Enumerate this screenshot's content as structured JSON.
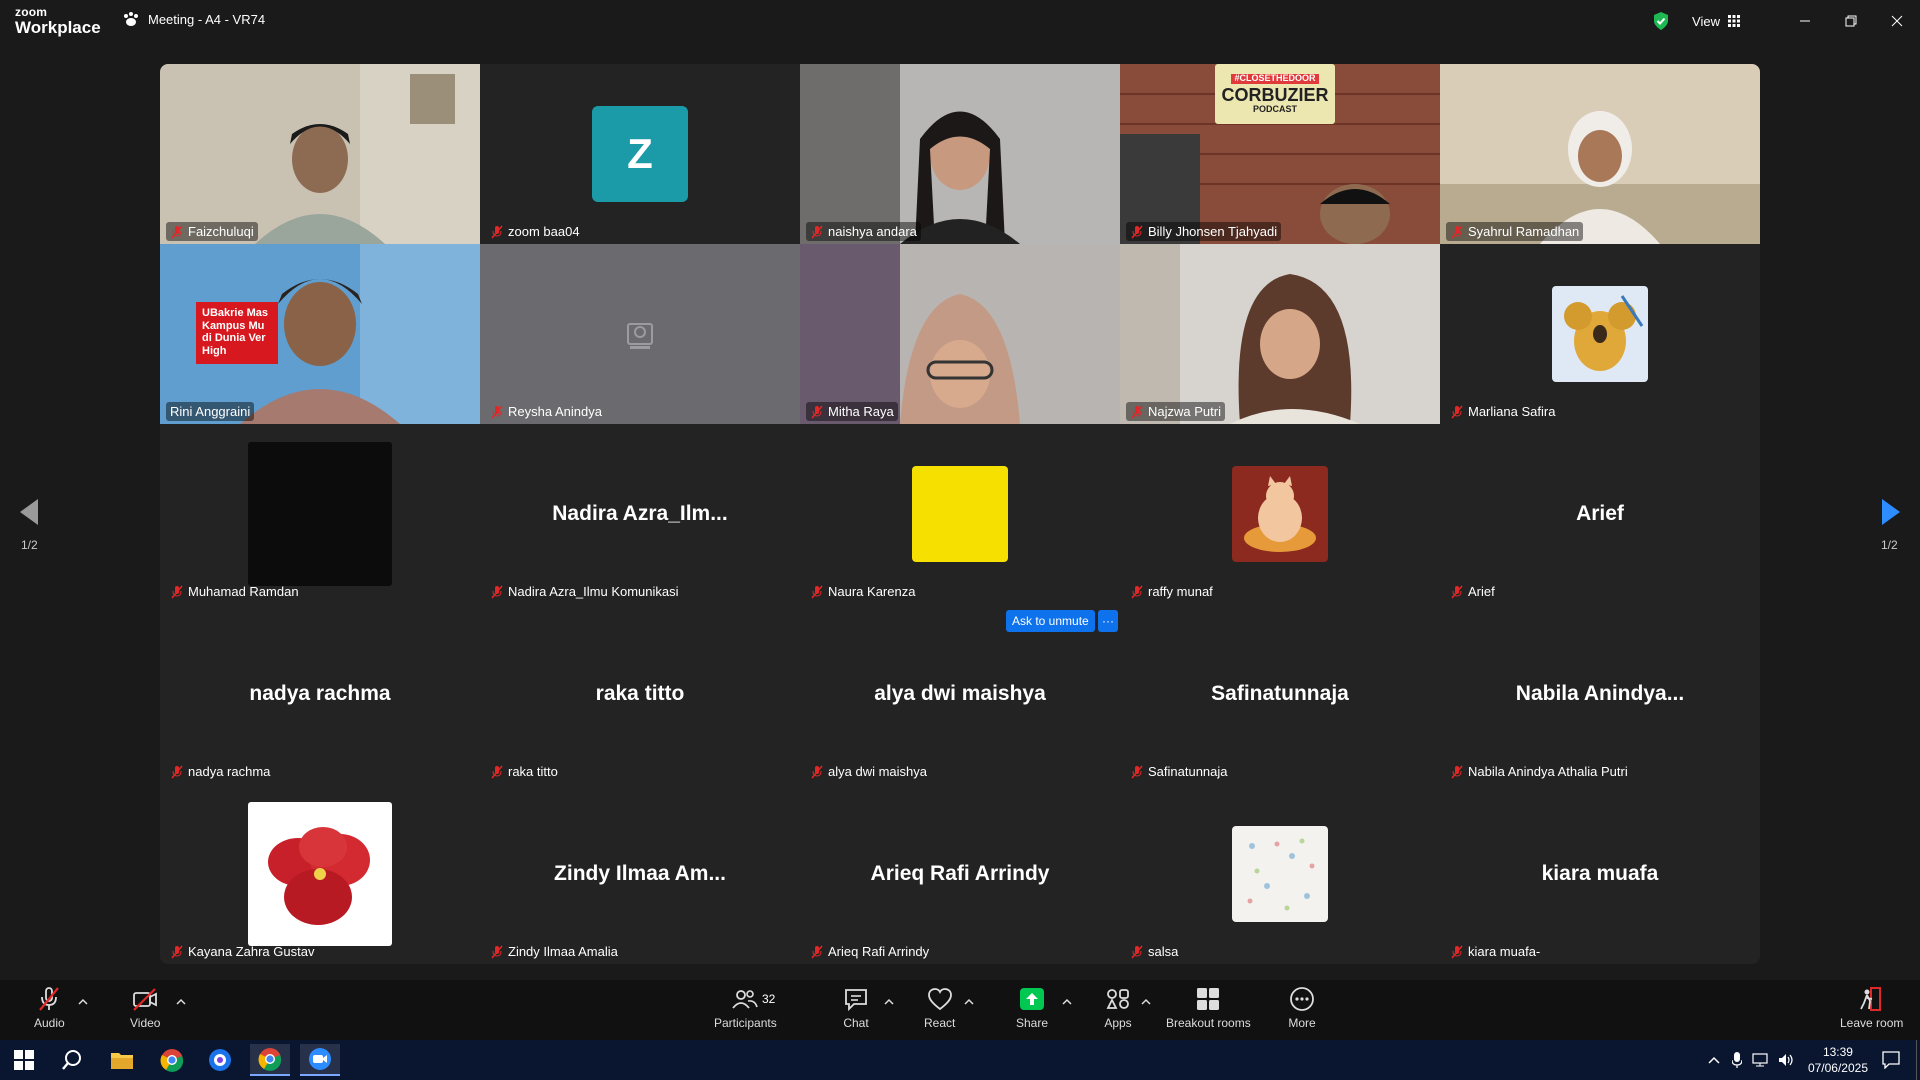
{
  "app": {
    "logo_line1": "zoom",
    "logo_line2": "Workplace",
    "meeting_title": "Meeting - A4 - VR74",
    "view_label": "View"
  },
  "tiles": [
    {
      "name": "Faizchuluqi"
    },
    {
      "name": "zoom baa04",
      "avatar_letter": "Z"
    },
    {
      "name": "naishya andara"
    },
    {
      "name": "Billy Jhonsen Tjahyadi",
      "banner_line1": "#CLOSETHEDOOR",
      "banner_line2": "CORBUZIER",
      "banner_line3": "PODCAST"
    },
    {
      "name": "Syahrul Ramadhan"
    },
    {
      "name": "Rini Anggraini",
      "banner_text": "UBakrie Mas Kampus Mu di Dunia Ver High"
    },
    {
      "name": "Reysha Anindya"
    },
    {
      "name": "Mitha Raya"
    },
    {
      "name": "Najzwa Putri"
    },
    {
      "name": "Marliana Safira"
    },
    {
      "name": "Muhamad Ramdan"
    },
    {
      "name": "Nadira Azra_Ilmu Komunikasi",
      "display": "Nadira  Azra_Ilm..."
    },
    {
      "name": "Naura Karenza"
    },
    {
      "name": "raffy munaf"
    },
    {
      "name": "Arief",
      "display": "Arief"
    },
    {
      "name": "nadya rachma",
      "display": "nadya rachma"
    },
    {
      "name": "raka titto",
      "display": "raka titto"
    },
    {
      "name": "alya dwi maishya",
      "display": "alya dwi maishya"
    },
    {
      "name": "Safinatunnaja",
      "display": "Safinatunnaja"
    },
    {
      "name": "Nabila Anindya Athalia Putri",
      "display": "Nabila  Anindya..."
    },
    {
      "name": "Kayana Zahra Gustav"
    },
    {
      "name": "Zindy Ilmaa Amalia",
      "display": "Zindy  Ilmaa  Am..."
    },
    {
      "name": "Arieq Rafi Arrindy",
      "display": "Arieq Rafi Arrindy"
    },
    {
      "name": "salsa"
    },
    {
      "name": "kiara muafa-",
      "display": "kiara muafa"
    }
  ],
  "pagination": {
    "left": "1/2",
    "right": "1/2"
  },
  "ask_to_unmute": "Ask to unmute",
  "more_dots": "···",
  "toolbar": {
    "audio": "Audio",
    "video": "Video",
    "participants": "Participants",
    "participants_count": "32",
    "chat": "Chat",
    "react": "React",
    "share": "Share",
    "apps": "Apps",
    "breakout": "Breakout rooms",
    "more": "More",
    "leave": "Leave room"
  },
  "taskbar": {
    "time": "13:39",
    "date": "07/06/2025"
  },
  "colors": {
    "accent": "#0e72ed",
    "active_speaker": "#2ecc71",
    "share_green": "#00c853",
    "mic_off_red": "#e02828",
    "avatar_teal": "#1b9aa8"
  }
}
